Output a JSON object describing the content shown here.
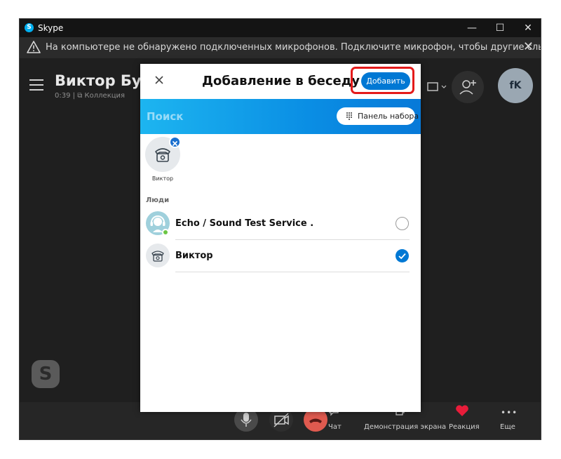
{
  "window": {
    "title": "Skype",
    "controls": {
      "minimize": "—",
      "maximize": "☐",
      "close": "✕"
    }
  },
  "warning": {
    "text": "На компьютере не обнаружено подключенных микрофонов. Подключите микрофон, чтобы другие слышали вас.",
    "close": "✕"
  },
  "call": {
    "name": "Виктор Бухт",
    "timer": "0:39",
    "separator": "|",
    "collection": "Коллекция",
    "avatar_initials": "fK"
  },
  "controls": {
    "chat": "Чат",
    "screen_share": "Демонстрация экрана",
    "reaction": "Реакция",
    "more": "Еще"
  },
  "dialog": {
    "title": "Добавление в беседу",
    "add_button": "Добавить",
    "search_placeholder": "Поиск",
    "dialpad_button": "Панель набора",
    "selected_chip": "Виктор",
    "section_label": "Люди",
    "people": [
      {
        "name": "Echo / Sound Test Service .",
        "selected": false,
        "online": true
      },
      {
        "name": "Виктор",
        "selected": true,
        "online": false
      }
    ]
  },
  "colors": {
    "accent": "#0078d4",
    "highlight": "#e41a1a",
    "search_gradient_start": "#1db5f0",
    "search_gradient_end": "#0779d8",
    "end_call": "#e05a4f",
    "reaction": "#e81c3a",
    "online": "#6cc644"
  }
}
